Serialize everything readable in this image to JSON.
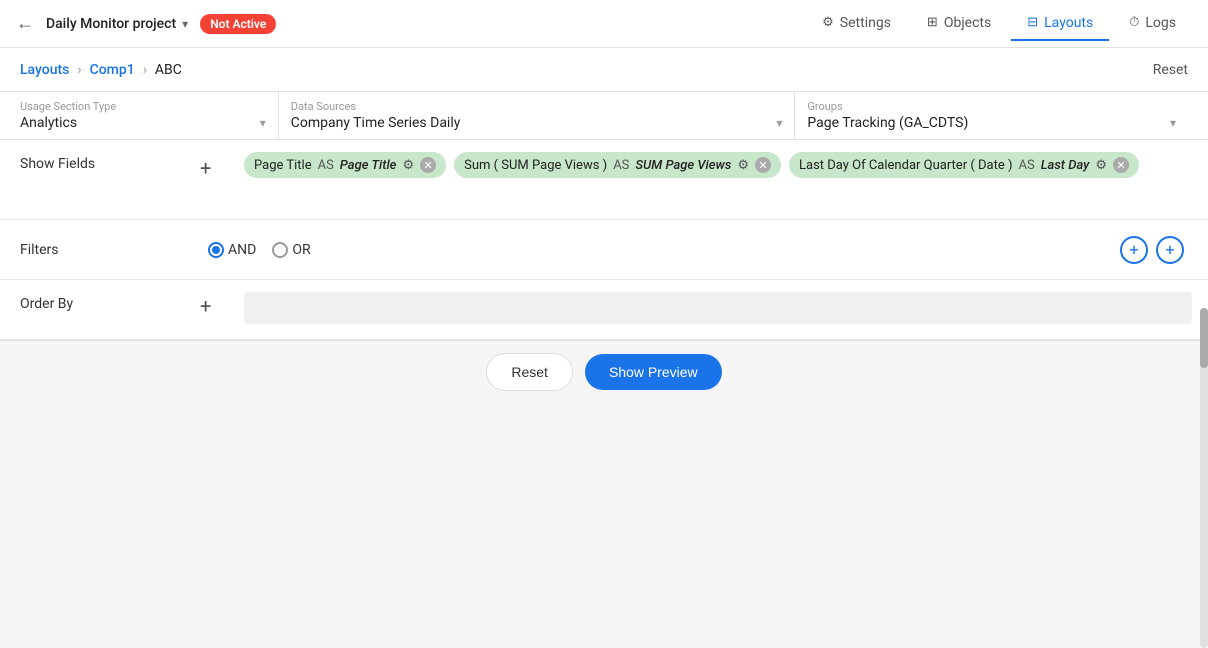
{
  "topNav": {
    "back_icon": "←",
    "project_name": "Daily Monitor project",
    "project_chevron": "▾",
    "status_badge": "Not Active",
    "tabs": [
      {
        "id": "settings",
        "label": "Settings",
        "icon": "⚙",
        "active": false
      },
      {
        "id": "objects",
        "label": "Objects",
        "icon": "⊞",
        "active": false
      },
      {
        "id": "layouts",
        "label": "Layouts",
        "icon": "⊟",
        "active": true
      },
      {
        "id": "logs",
        "label": "Logs",
        "icon": "⏱",
        "active": false
      }
    ]
  },
  "breadcrumb": {
    "items": [
      {
        "label": "Layouts"
      },
      {
        "label": "Comp1"
      },
      {
        "label": "ABC"
      }
    ],
    "reset_label": "Reset"
  },
  "sectionType": {
    "label": "Usage Section Type",
    "value": "Analytics",
    "arrow": "▾"
  },
  "dataSources": {
    "label": "Data Sources",
    "value": "Company Time Series Daily",
    "arrow": "▾"
  },
  "groups": {
    "label": "Groups",
    "value": "Page Tracking (GA_CDTS)",
    "arrow": "▾"
  },
  "showFields": {
    "label": "Show Fields",
    "add_icon": "+",
    "fields": [
      {
        "id": "field1",
        "name": "Page Title",
        "as_label": "AS",
        "alias": "Page Title",
        "italic_alias": true
      },
      {
        "id": "field2",
        "name": "Sum ( SUM Page Views )",
        "as_label": "AS",
        "alias": "SUM Page Views",
        "italic_alias": true
      },
      {
        "id": "field3",
        "name": "Last Day Of Calendar Quarter ( Date )",
        "as_label": "AS",
        "alias": "Last Day",
        "italic_alias": true
      }
    ]
  },
  "filters": {
    "label": "Filters",
    "and_label": "AND",
    "or_label": "OR",
    "add_icon": "+",
    "add_circle_icon": "+"
  },
  "orderBy": {
    "label": "Order By",
    "add_icon": "+"
  },
  "bottomBar": {
    "reset_label": "Reset",
    "show_preview_label": "Show Preview"
  }
}
